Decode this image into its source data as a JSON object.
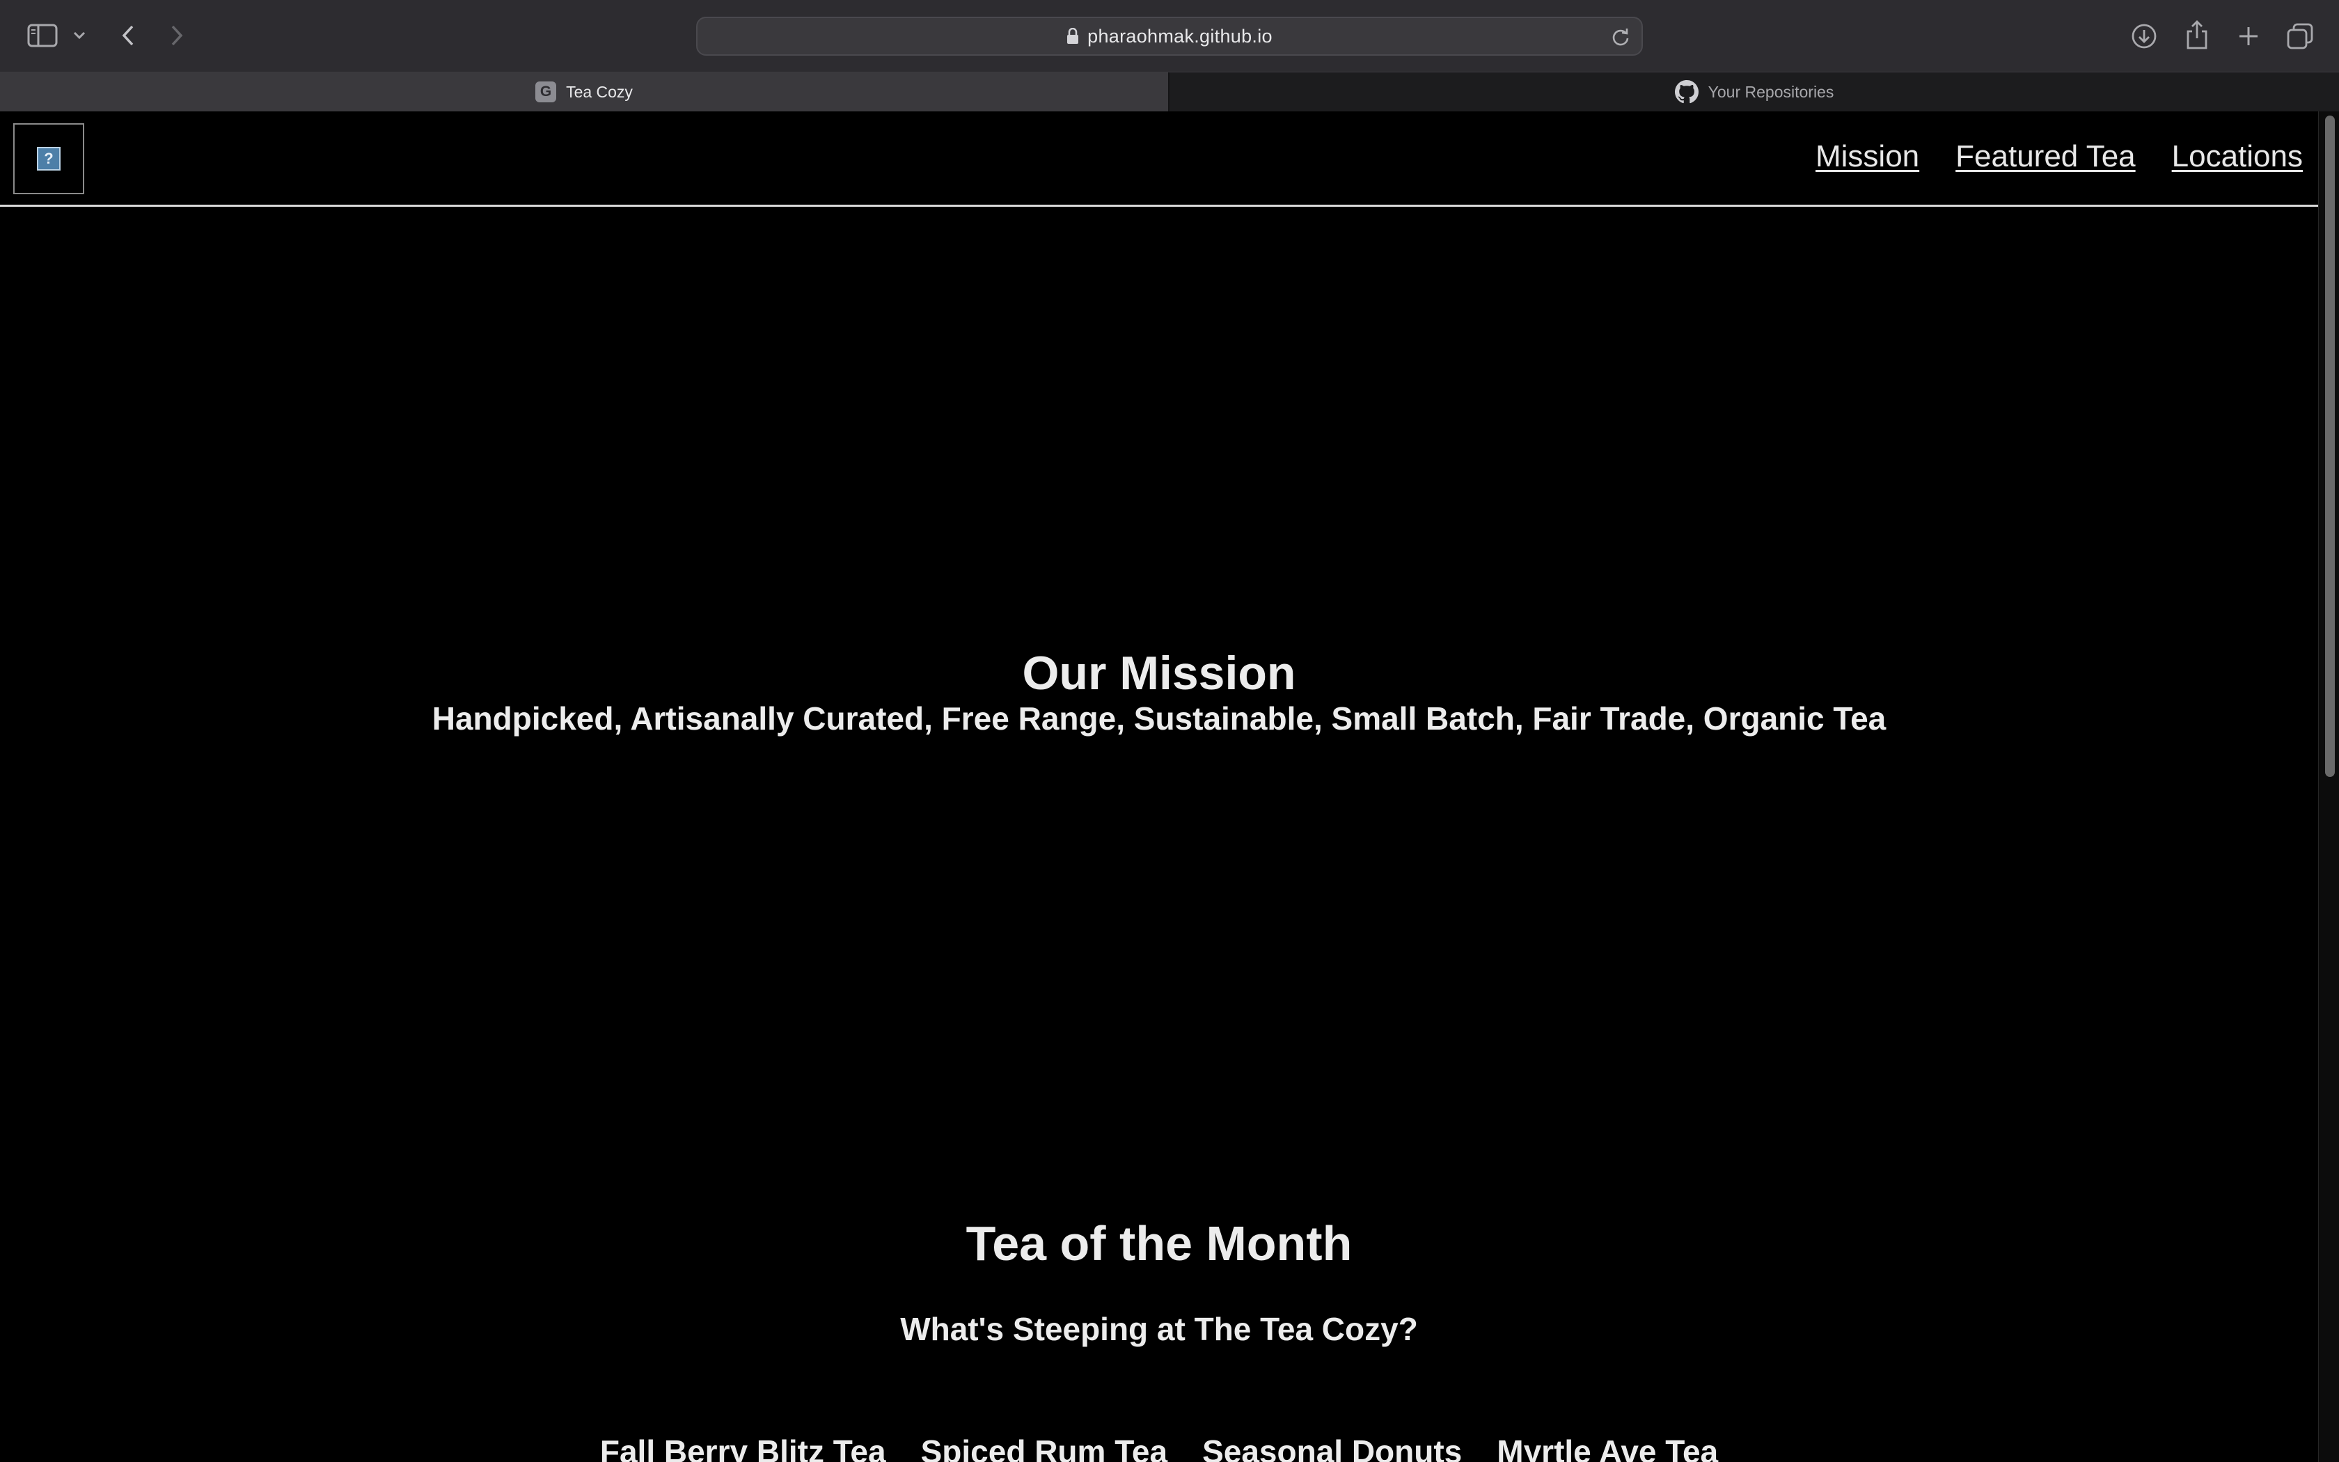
{
  "browser": {
    "url": "pharaohmak.github.io",
    "tabs": [
      {
        "label": "Tea Cozy",
        "favicon_letter": "G",
        "active": true
      },
      {
        "label": "Your Repositories",
        "active": false
      }
    ],
    "icons": {
      "sidebar": "sidebar-icon",
      "sidebar_menu": "chevron-down-icon",
      "back": "chevron-left-icon",
      "forward": "chevron-right-icon",
      "lock": "lock-icon",
      "reload": "reload-icon",
      "downloads": "download-icon",
      "share": "share-icon",
      "new_tab": "plus-icon",
      "tab_overview": "tabs-icon"
    }
  },
  "site": {
    "logo_placeholder": "?",
    "nav": [
      "Mission",
      "Featured Tea",
      "Locations"
    ],
    "mission": {
      "title": "Our Mission",
      "subtitle": "Handpicked, Artisanally Curated, Free Range, Sustainable, Small Batch, Fair Trade, Organic Tea"
    },
    "tea_of_month": {
      "title": "Tea of the Month",
      "subtitle": "What's Steeping at The Tea Cozy?",
      "items": [
        "Fall Berry Blitz Tea",
        "Spiced Rum Tea",
        "Seasonal Donuts",
        "Myrtle Ave Tea"
      ]
    }
  },
  "colors": {
    "page_background": "#000000",
    "text": "#ececec",
    "chrome_toolbar": "#2d2c30"
  }
}
